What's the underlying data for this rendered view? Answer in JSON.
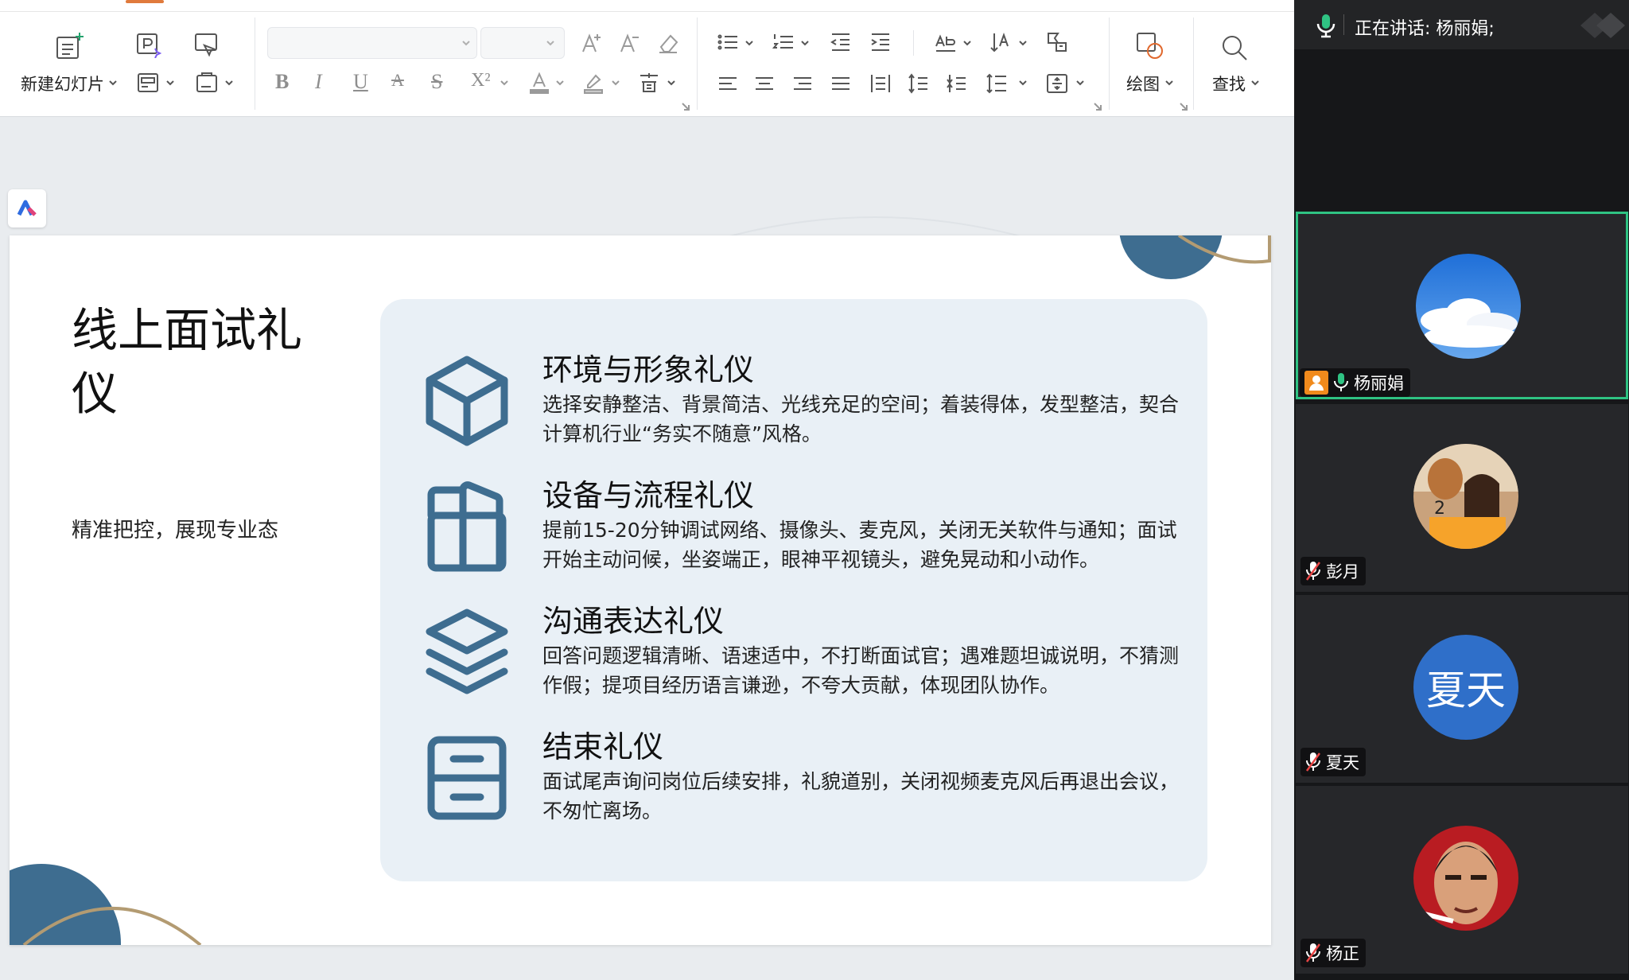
{
  "ribbon": {
    "new_slide_label": "新建幻灯片",
    "draw_label": "绘图",
    "find_label": "查找"
  },
  "slide": {
    "title": "线上面试礼仪",
    "subtitle": "精准把控，展现专业态",
    "items": [
      {
        "heading": "环境与形象礼仪",
        "desc": "选择安静整洁、背景简洁、光线充足的空间；着装得体，发型整洁，契合计算机行业“务实不随意”风格。",
        "icon": "cube-icon"
      },
      {
        "heading": "设备与流程礼仪",
        "desc": "提前15-20分钟调试网络、摄像头、麦克风，关闭无关软件与通知；面试开始主动问候，坐姿端正，眼神平视镜头，避免晃动和小动作。",
        "icon": "book-icon"
      },
      {
        "heading": "沟通表达礼仪",
        "desc": "回答问题逻辑清晰、语速适中，不打断面试官；遇难题坦诚说明，不猜测作假；提项目经历语言谦逊，不夸大贡献，体现团队协作。",
        "icon": "layers-icon"
      },
      {
        "heading": "结束礼仪",
        "desc": "面试尾声询问岗位后续安排，礼貌道别，关闭视频麦克风后再退出会议，不匆忙离场。",
        "icon": "archive-icon"
      }
    ]
  },
  "meeting": {
    "speaking_label": "正在讲话:",
    "speaking_name": "杨丽娟;",
    "participants": [
      {
        "name": "杨丽娟",
        "mic": "on",
        "avatar": "sky-avatar",
        "active": true
      },
      {
        "name": "彭月",
        "mic": "muted",
        "avatar": "photo-avatar"
      },
      {
        "name": "夏天",
        "mic": "muted",
        "avatar_text": "夏天",
        "avatar_color": "#2f6fc9"
      },
      {
        "name": "杨正",
        "mic": "muted",
        "avatar": "photo-avatar"
      }
    ]
  },
  "colors": {
    "accent": "#3e6d90",
    "active_border": "#2fc383",
    "card_bg": "#e9f0f6",
    "tab_accent": "#e07a3c"
  }
}
